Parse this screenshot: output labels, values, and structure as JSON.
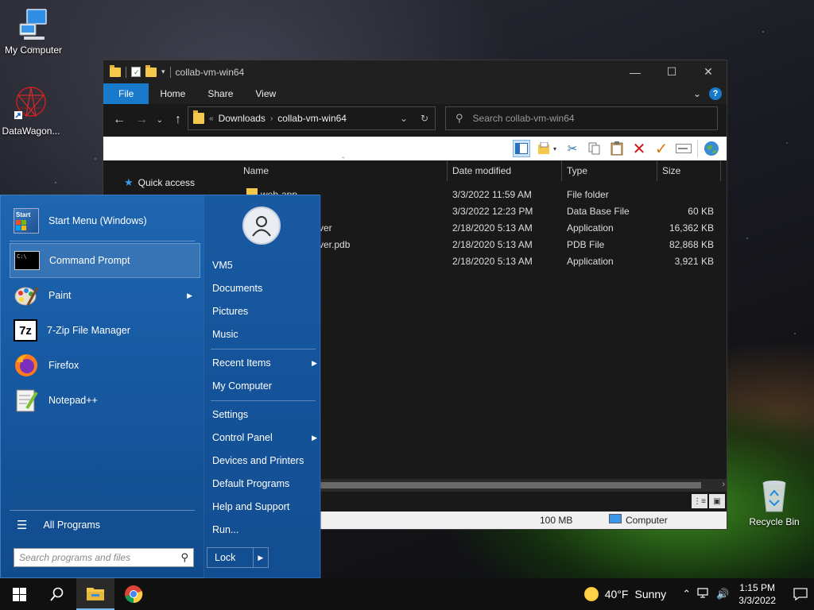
{
  "desktop": {
    "icons": [
      {
        "label": "My Computer"
      },
      {
        "label": "DataWagon..."
      },
      {
        "label": "Recycle Bin"
      }
    ]
  },
  "explorer": {
    "title": "collab-vm-win64",
    "tabs": {
      "file": "File",
      "home": "Home",
      "share": "Share",
      "view": "View"
    },
    "address": {
      "prefix": "«",
      "crumbs": [
        "Downloads",
        "collab-vm-win64"
      ]
    },
    "search_placeholder": "Search collab-vm-win64",
    "nav": {
      "quick_access": "Quick access"
    },
    "columns": {
      "name": "Name",
      "date": "Date modified",
      "type": "Type",
      "size": "Size"
    },
    "files": [
      {
        "name": "web-app",
        "date": "3/3/2022 11:59 AM",
        "type": "File folder",
        "size": ""
      },
      {
        "name": "",
        "date": "3/3/2022 12:23 PM",
        "type": "Data Base File",
        "size": "60 KB"
      },
      {
        "name": "ver",
        "date": "2/18/2020 5:13 AM",
        "type": "Application",
        "size": "16,362 KB"
      },
      {
        "name": "ver.pdb",
        "date": "2/18/2020 5:13 AM",
        "type": "PDB File",
        "size": "82,868 KB"
      },
      {
        "name": "",
        "date": "2/18/2020 5:13 AM",
        "type": "Application",
        "size": "3,921 KB"
      }
    ],
    "status": {
      "size": "100 MB",
      "location": "Computer"
    }
  },
  "start_menu": {
    "programs": [
      {
        "label": "Start Menu (Windows)"
      },
      {
        "label": "Command Prompt"
      },
      {
        "label": "Paint",
        "submenu": "▶"
      },
      {
        "label": "7-Zip File Manager"
      },
      {
        "label": "Firefox"
      },
      {
        "label": "Notepad++"
      }
    ],
    "start_icon_text": "Start",
    "cmd_icon_text": "C:\\",
    "zip_icon_text": "7z",
    "all_programs": "All Programs",
    "search_placeholder": "Search programs and files",
    "right": {
      "user": "VM5",
      "documents": "Documents",
      "pictures": "Pictures",
      "music": "Music",
      "recent_items": "Recent Items",
      "my_computer": "My Computer",
      "settings": "Settings",
      "control_panel": "Control Panel",
      "devices_printers": "Devices and Printers",
      "default_programs": "Default Programs",
      "help_support": "Help and Support",
      "run": "Run...",
      "submenu_arrow": "▶"
    },
    "lock": "Lock",
    "lock_arrow": "▶"
  },
  "taskbar": {
    "weather_temp": "40°F",
    "weather_cond": "Sunny",
    "time": "1:15 PM",
    "date": "3/3/2022"
  }
}
